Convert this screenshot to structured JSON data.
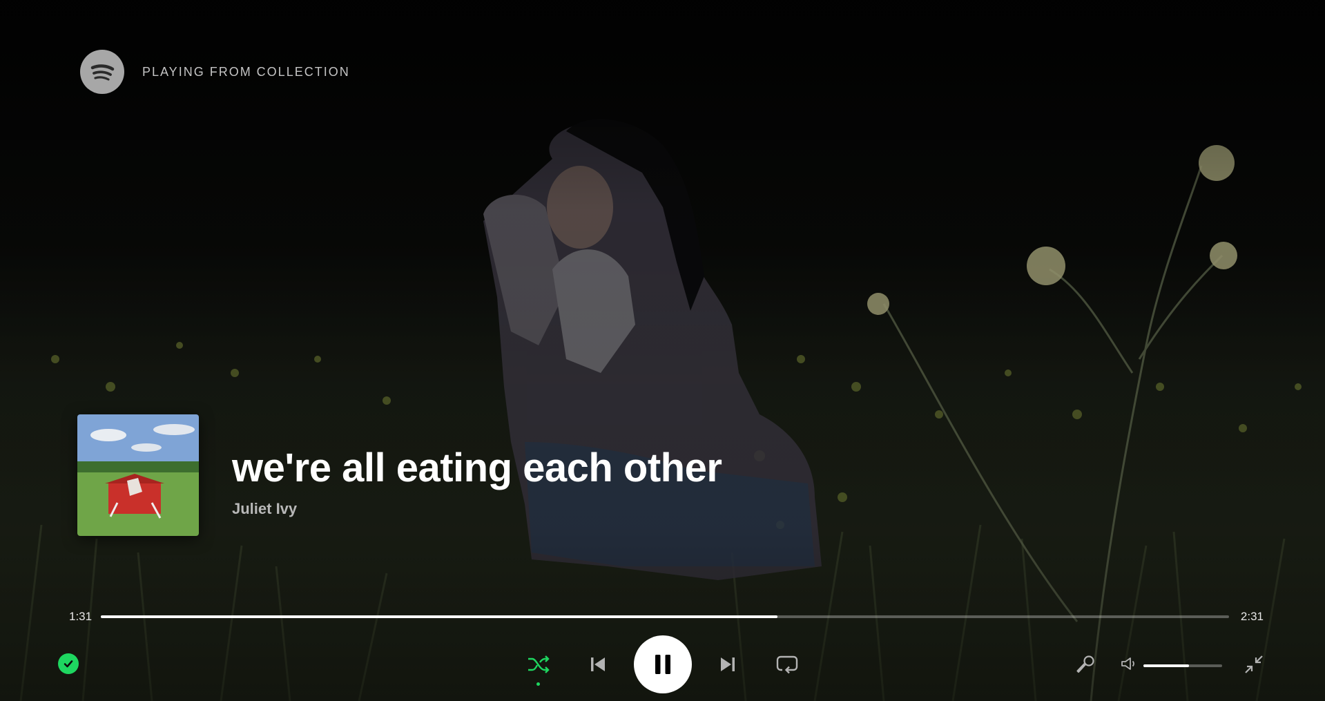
{
  "header": {
    "context_label": "PLAYING FROM COLLECTION"
  },
  "track": {
    "title": "we're all eating each other",
    "artist": "Juliet Ivy"
  },
  "playback": {
    "elapsed": "1:31",
    "duration": "2:31",
    "progress": 0.6,
    "volume": 0.58,
    "shuffle_enabled": true
  },
  "icons": {
    "logo": "spotify-logo",
    "saved": "check-circle-icon",
    "shuffle": "shuffle-icon",
    "previous": "skip-back-icon",
    "play_pause": "pause-icon",
    "next": "skip-forward-icon",
    "repeat": "repeat-icon",
    "lyrics": "microphone-icon",
    "volume": "volume-icon",
    "minimize": "minimize-icon"
  },
  "colors": {
    "accent": "#1ed760",
    "text_primary": "#ffffff",
    "text_secondary": "#b8b8b8"
  }
}
